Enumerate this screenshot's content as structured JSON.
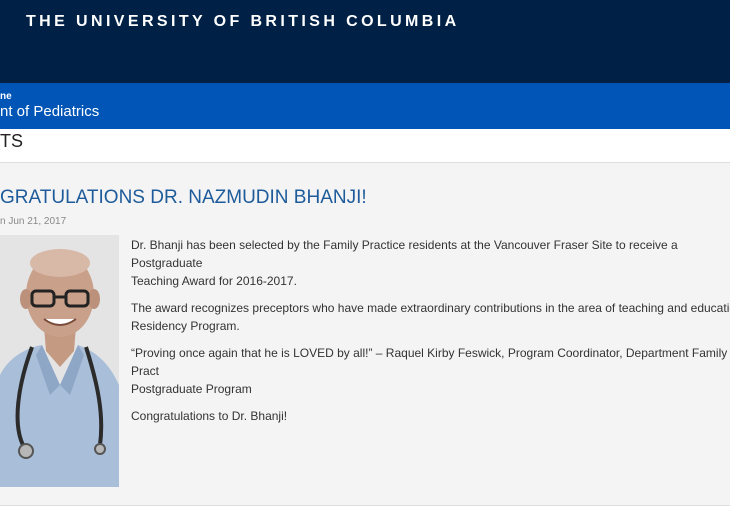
{
  "header": {
    "university_name": "THE UNIVERSITY OF BRITISH COLUMBIA",
    "unit_small": "ne",
    "unit_name": "nt of Pediatrics",
    "bar_color": "#002145",
    "unit_bar_color": "#0055b7"
  },
  "section": {
    "title": "TS"
  },
  "post": {
    "title": "GRATULATIONS DR. NAZMUDIN BHANJI!",
    "date": "n Jun 21, 2017",
    "photo_icon": "portrait-photo",
    "paragraphs": [
      "Dr. Bhanji has been selected by the Family Practice residents at the Vancouver Fraser Site to receive a Postgraduate\nTeaching Award for 2016-2017.",
      "The award recognizes preceptors who have made extraordinary contributions in the area of teaching and education i\nResidency Program.",
      "“Proving once again that he is LOVED by all!” – Raquel Kirby Feswick, Program Coordinator, Department Family Pract\nPostgraduate Program",
      "Congratulations to Dr. Bhanji!"
    ]
  }
}
